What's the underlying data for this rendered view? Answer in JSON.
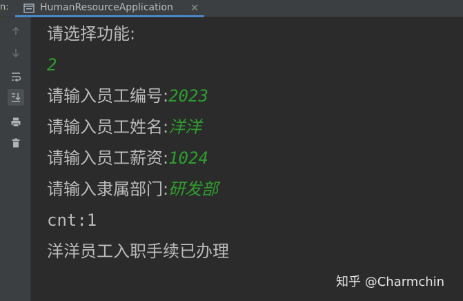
{
  "tabbar": {
    "run_label": "n:",
    "tab_title": "HumanResourceApplication",
    "tab_icon": "console-icon",
    "close_icon": "close-icon"
  },
  "toolbar": {
    "items": [
      {
        "name": "arrow-up-icon"
      },
      {
        "name": "arrow-down-icon"
      },
      {
        "name": "soft-wrap-icon"
      },
      {
        "name": "scroll-to-end-icon"
      },
      {
        "name": "print-icon"
      },
      {
        "name": "trash-icon"
      }
    ]
  },
  "console": {
    "line1": "请选择功能:",
    "line2_input": "2",
    "line3_prompt": "请输入员工编号:",
    "line3_input": "2023",
    "line4_prompt": "请输入员工姓名:",
    "line4_input": "洋洋",
    "line5_prompt": "请输入员工薪资:",
    "line5_input": "1024",
    "line6_prompt": "请输入隶属部门:",
    "line6_input": "研发部",
    "line7": "cnt:1",
    "line8": "洋洋员工入职手续已办理"
  },
  "watermark": "知乎 @Charmchin",
  "colors": {
    "background": "#2b2b2b",
    "panel": "#3c3f41",
    "text": "#bbbbbb",
    "user_input": "#2e9e2e",
    "tab_accent": "#4a88c7"
  }
}
